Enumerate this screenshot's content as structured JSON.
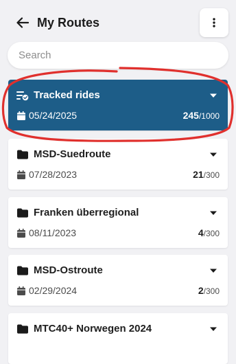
{
  "header": {
    "title": "My Routes",
    "back_icon": "arrow-left-icon",
    "menu_icon": "more-vertical-icon"
  },
  "search": {
    "placeholder": "Search",
    "value": ""
  },
  "routes": [
    {
      "title": "Tracked rides",
      "date": "05/24/2025",
      "count": "245",
      "max": "/1000",
      "icon": "tracked-rides-icon",
      "selected": true
    },
    {
      "title": "MSD-Suedroute",
      "date": "07/28/2023",
      "count": "21",
      "max": "/300",
      "icon": "folder-icon",
      "selected": false
    },
    {
      "title": "Franken überregional",
      "date": "08/11/2023",
      "count": "4",
      "max": "/300",
      "icon": "folder-icon",
      "selected": false
    },
    {
      "title": "MSD-Ostroute",
      "date": "02/29/2024",
      "count": "2",
      "max": "/300",
      "icon": "folder-icon",
      "selected": false
    },
    {
      "title": "MTC40+ Norwegen 2024",
      "date": "",
      "count": "",
      "max": "",
      "icon": "folder-icon",
      "selected": false
    }
  ],
  "colors": {
    "background": "#f1f1f4",
    "selected_card": "#1d5d88",
    "card": "#ffffff",
    "annotation_stroke": "#e0302d"
  }
}
